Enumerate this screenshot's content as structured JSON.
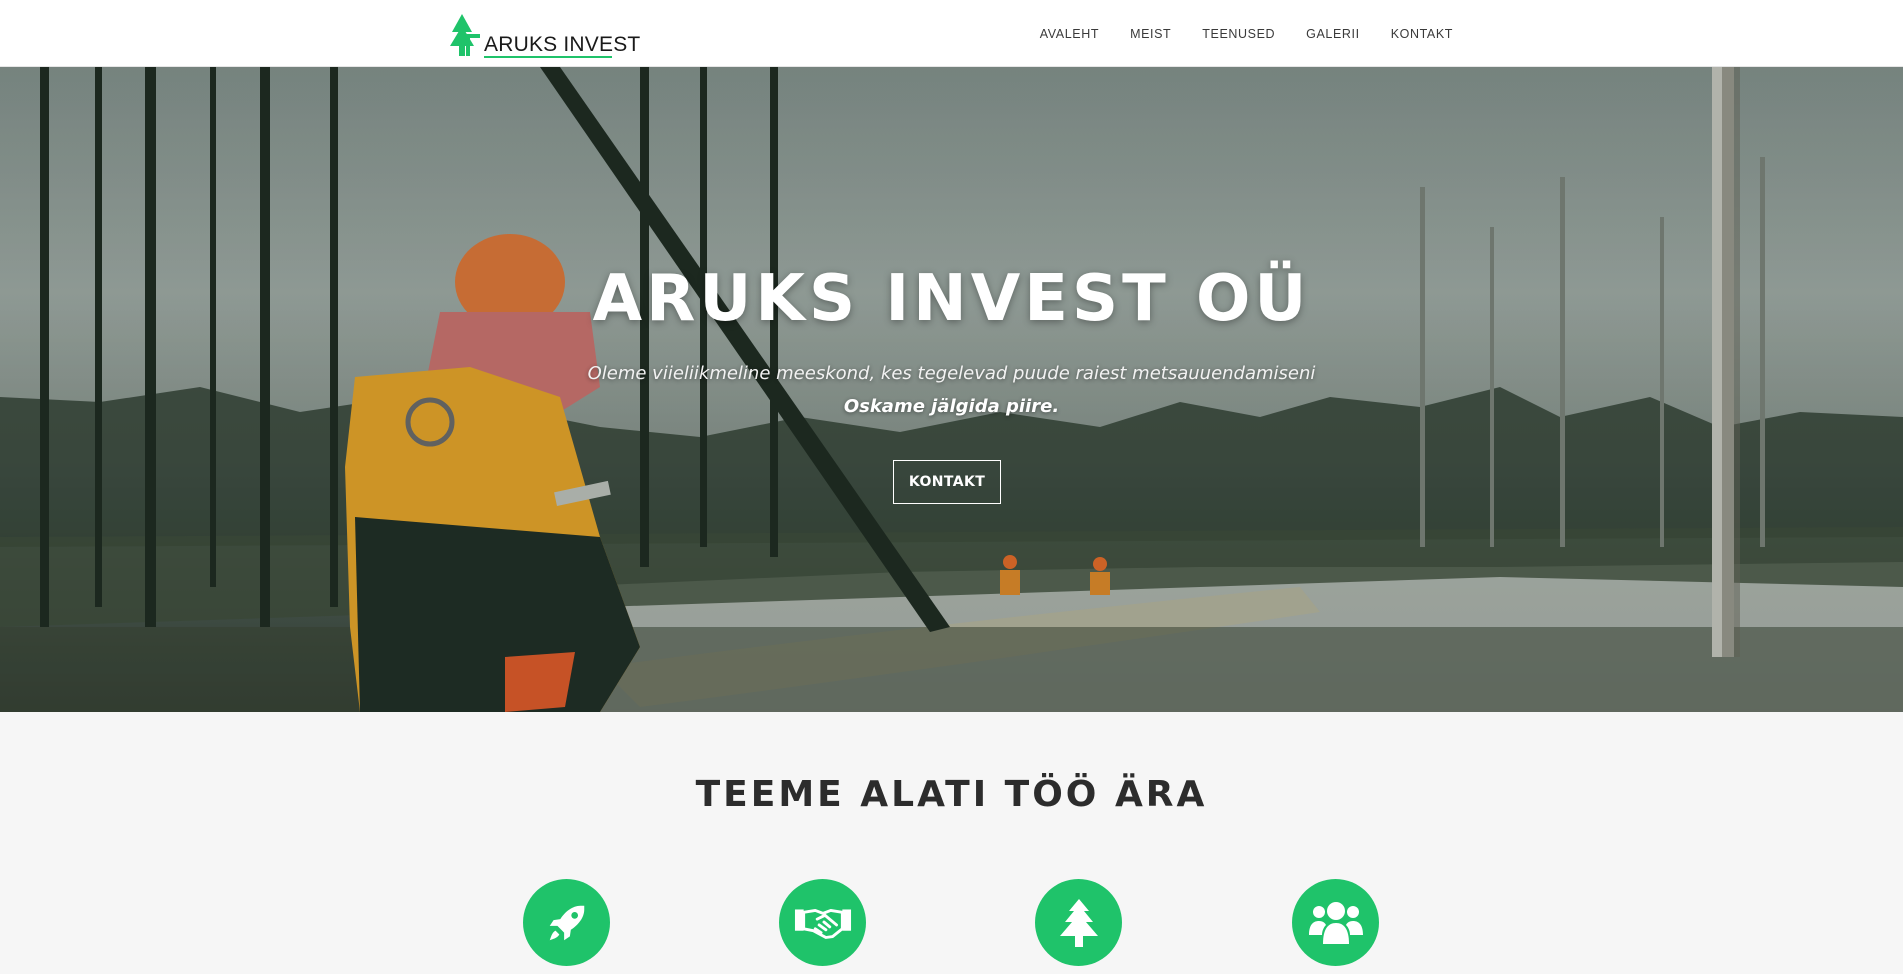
{
  "header": {
    "logo_text": "ARUKS INVEST",
    "nav": [
      {
        "label": "AVALEHT"
      },
      {
        "label": "MEIST"
      },
      {
        "label": "TEENUSED"
      },
      {
        "label": "GALERII"
      },
      {
        "label": "KONTAKT"
      }
    ]
  },
  "hero": {
    "title": "ARUKS INVEST OÜ",
    "subtitle": "Oleme viieliikmeline meeskond, kes tegelevad puude raiest metsauuendamiseni",
    "tagline": "Oskame jälgida piire.",
    "button_label": "KONTAKT"
  },
  "section": {
    "title": "TEEME ALATI TÖÖ ÄRA",
    "features": [
      {
        "icon": "rocket-icon"
      },
      {
        "icon": "handshake-icon"
      },
      {
        "icon": "tree-icon"
      },
      {
        "icon": "users-icon"
      }
    ]
  },
  "colors": {
    "accent": "#1fc36a",
    "text_dark": "#2c2c2c",
    "header_bg": "#ffffff",
    "section_bg": "#f6f6f6"
  }
}
